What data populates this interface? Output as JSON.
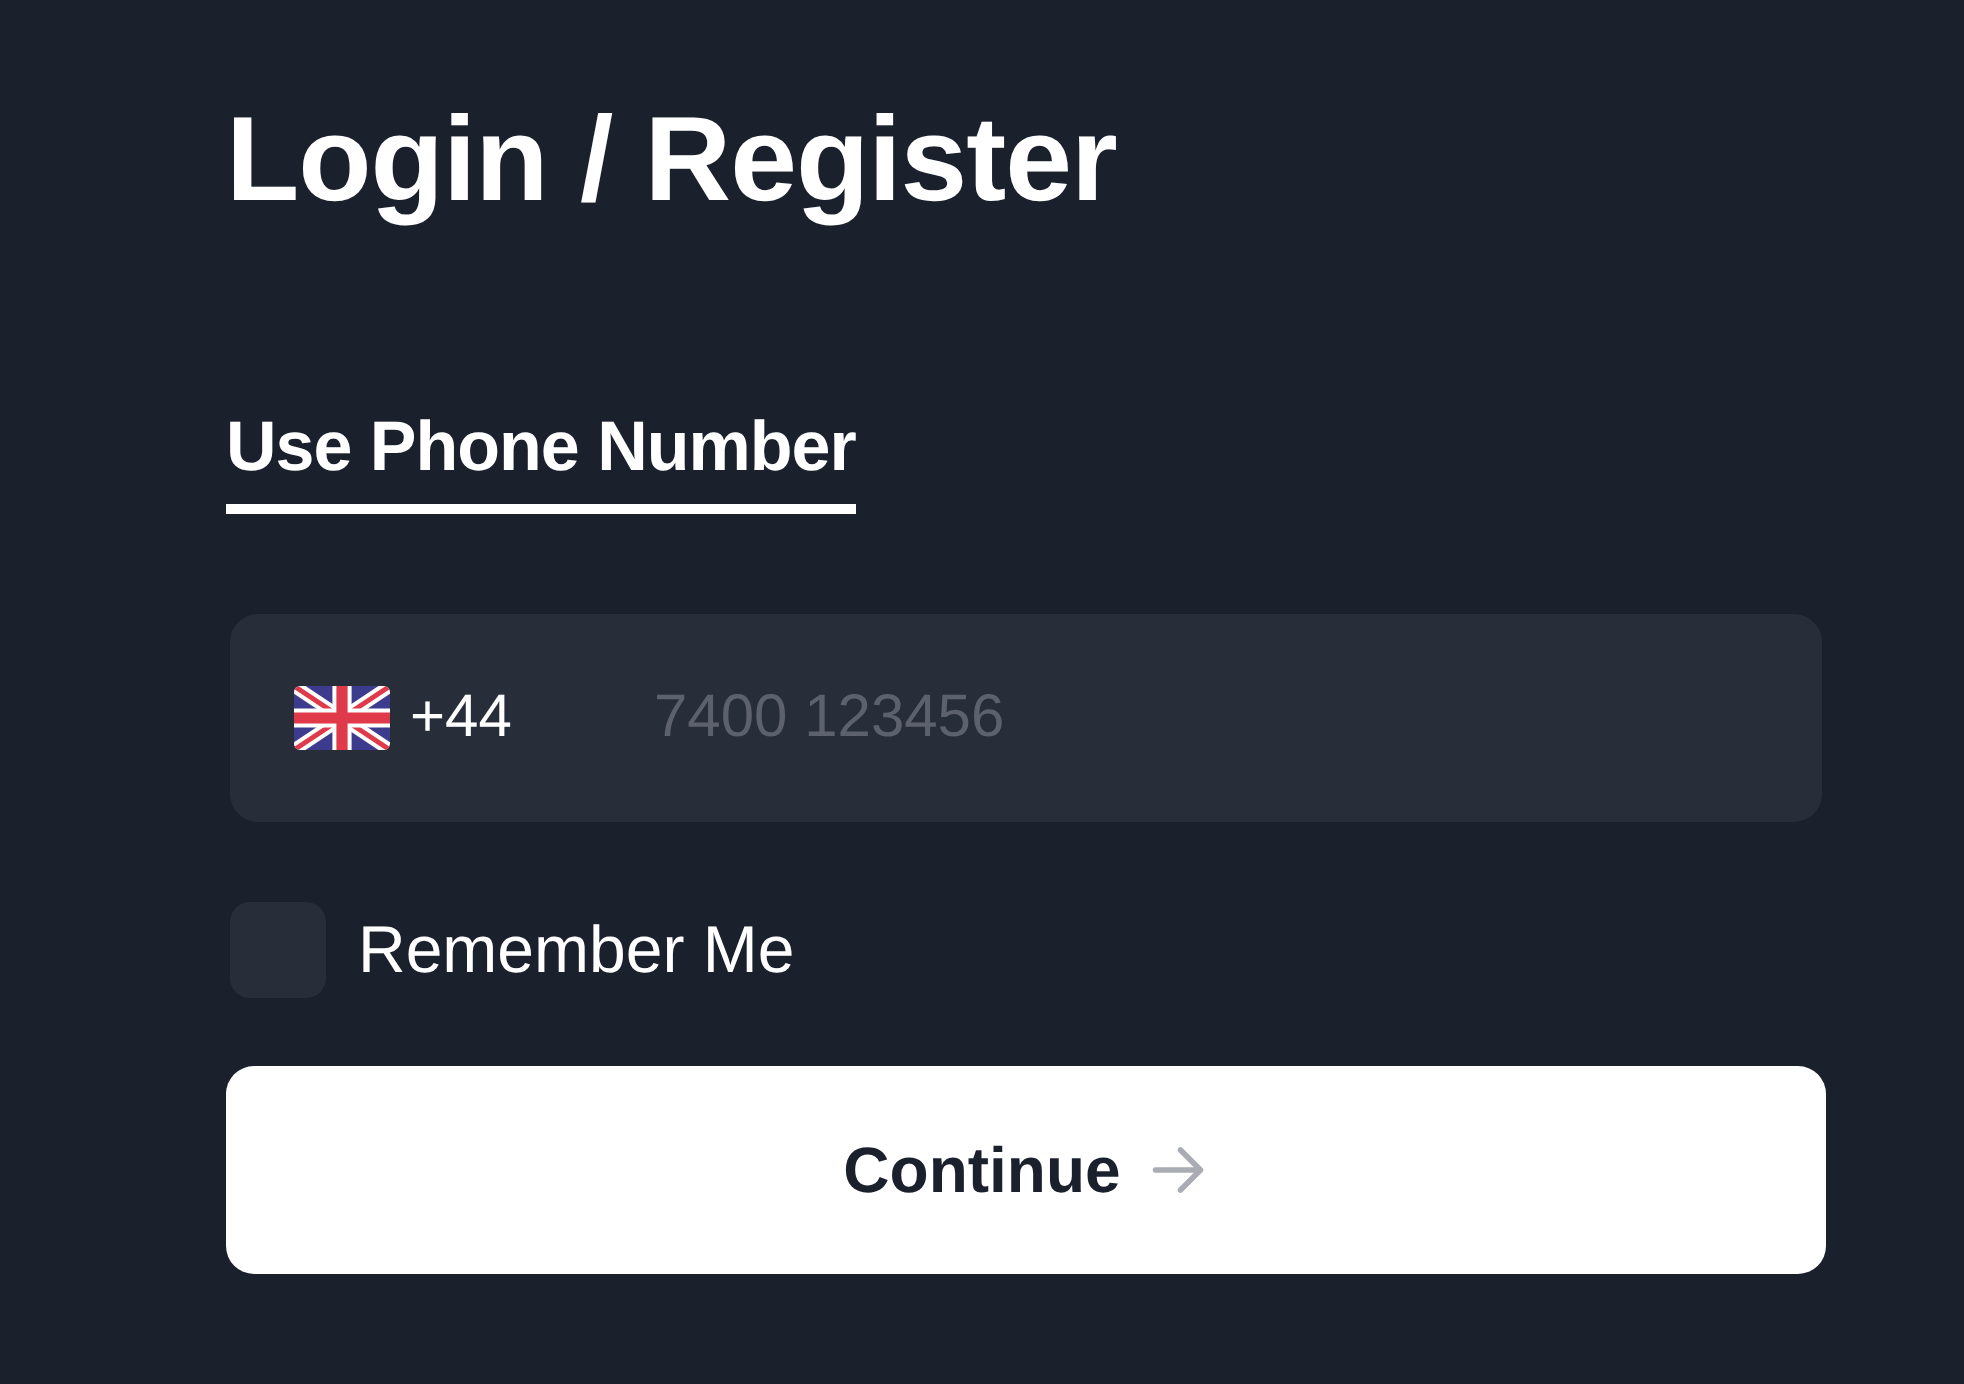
{
  "title": "Login / Register",
  "tabs": [
    {
      "label": "Use Phone Number",
      "selected": true
    }
  ],
  "phone_field": {
    "country_code": "+44",
    "placeholder": "7400 123456"
  },
  "remember_me": {
    "label": "Remember Me",
    "checked": false
  },
  "continue_button": {
    "label": "Continue"
  }
}
